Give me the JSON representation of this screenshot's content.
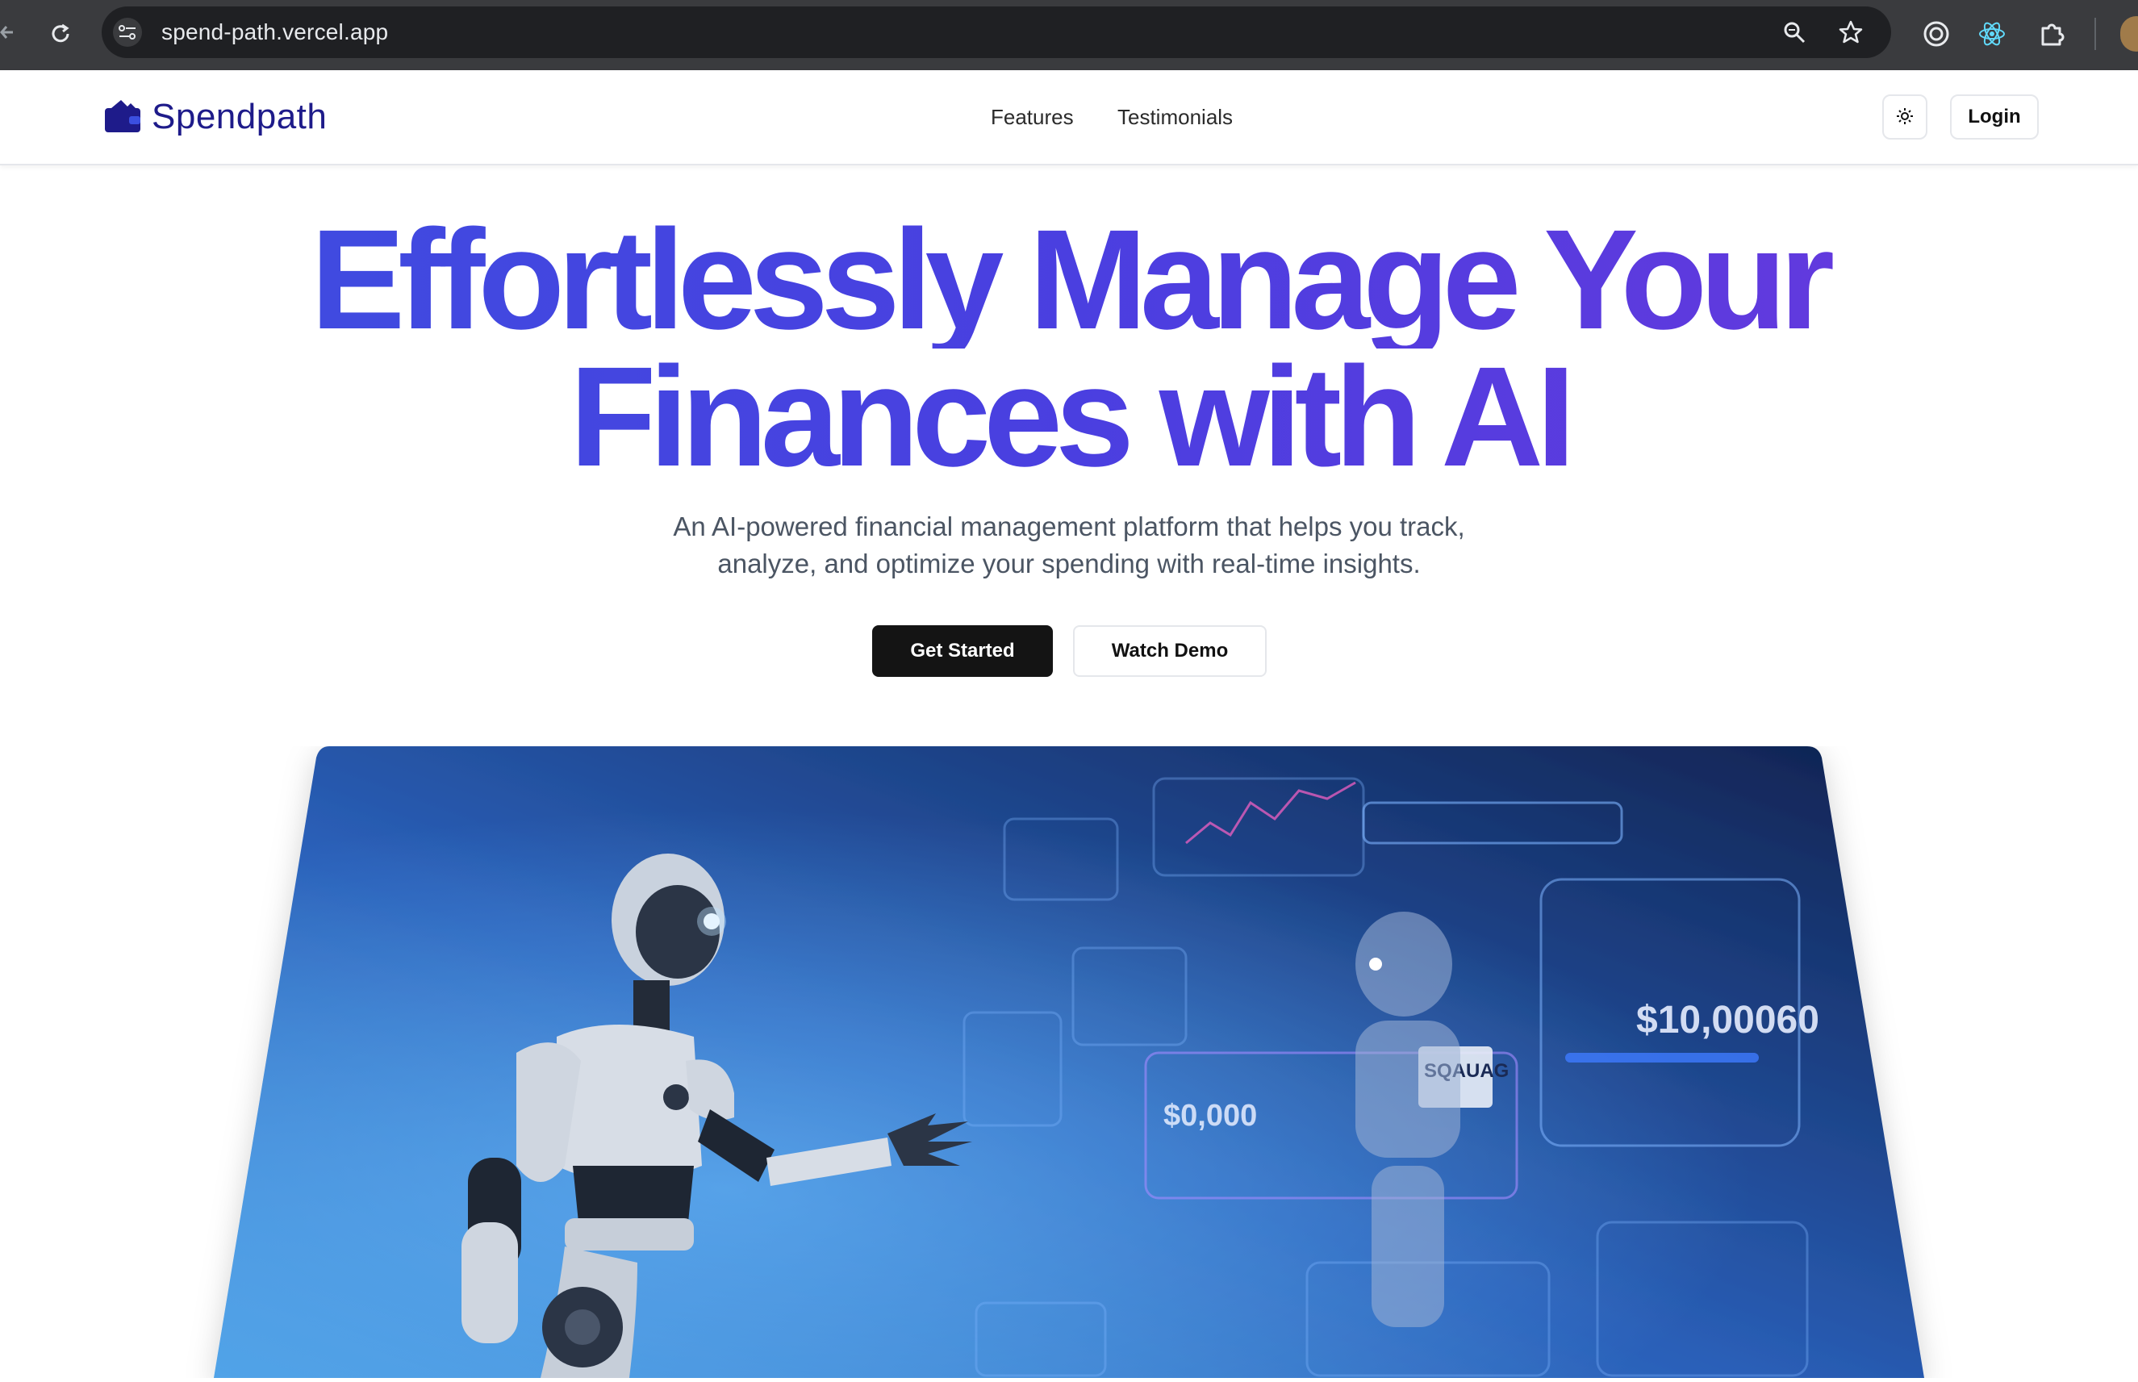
{
  "browser": {
    "url": "spend-path.vercel.app",
    "icons": [
      "back-arrow-icon",
      "reload-icon",
      "site-info-icon",
      "zoom-icon",
      "bookmark-star-icon",
      "extension-target-icon",
      "react-devtools-icon",
      "extensions-puzzle-icon",
      "profile-avatar"
    ]
  },
  "header": {
    "brand": "Spendpath",
    "nav": [
      "Features",
      "Testimonials"
    ],
    "login": "Login",
    "theme_icon": "sun-icon"
  },
  "hero": {
    "title_line1": "Effortlessly Manage Your",
    "title_line2": "Finances with AI",
    "subtitle_line1": "An AI-powered financial management platform that helps you track,",
    "subtitle_line2": "analyze, and optimize your spending with real-time insights.",
    "cta_primary": "Get Started",
    "cta_secondary": "Watch Demo"
  },
  "hero_image": {
    "labels": {
      "total_value": "$10,00060",
      "card_value": "$0,000",
      "tag": "SQAUAG"
    }
  },
  "colors": {
    "gradient_start": "#3b4fe0",
    "gradient_end": "#6b37dd",
    "brand": "#1e1b8a",
    "primary_button": "#141414"
  }
}
